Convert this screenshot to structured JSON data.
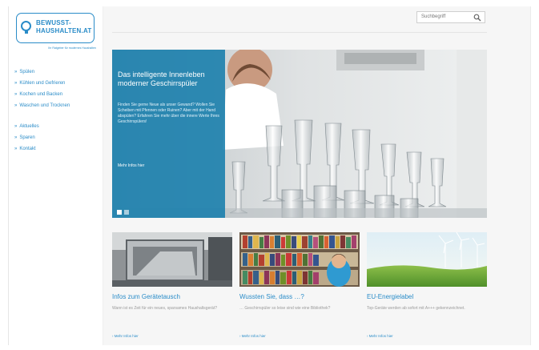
{
  "logo": {
    "line1": "BEWUSST-",
    "line2": "HAUSHALTEN.AT",
    "tagline": "Ihr Ratgeber für modernes Haushalten"
  },
  "search": {
    "placeholder": "Suchbegriff",
    "icon": "search-icon"
  },
  "nav": {
    "primary": [
      "Spülen",
      "Kühlen und Gefrieren",
      "Kochen und Backen",
      "Waschen und Trocknen"
    ],
    "secondary": [
      "Aktuelles",
      "Sparen",
      "Kontakt"
    ]
  },
  "hero": {
    "title": "Das intelligente Innenleben moderner Geschirrspüler",
    "text": "Finden Sie gerne Neue als unser Gewand? Wollen Sie Scheiben mit Pfennen oder Ruinen? Aber mit der Hand abspülen? Erfahren Sie mehr über die innere Werte Ihres Geschirrspülers!",
    "link": "Mehr Infos hier",
    "slides": 2,
    "accent": "#167dac"
  },
  "teasers": [
    {
      "title": "Infos zum Gerätetausch",
      "text": "Wann ist es Zeit für ein neues, sparsames Haushaltsgerät?",
      "link": "› Mehr Infos hier",
      "image": "appliance-photo"
    },
    {
      "title": "Wussten Sie, dass …?",
      "text": "… Geschirrspüler so leise sind wie eine Bibliothek?",
      "link": "› Mehr Infos hier",
      "image": "library-photo"
    },
    {
      "title": "EU-Energielabel",
      "text": "Top-Geräte werden ab sofort mit A+++ gekennzeichnet.",
      "link": "› Mehr Infos hier",
      "image": "wind-turbine-photo"
    }
  ],
  "colors": {
    "brand": "#2a8cc8",
    "page": "#ffffff",
    "main": "#f6f6f6"
  }
}
